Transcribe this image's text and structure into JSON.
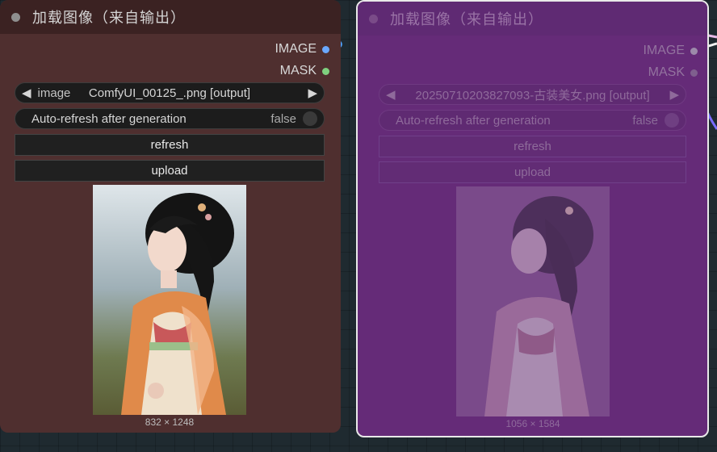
{
  "nodes": [
    {
      "title": "加载图像（来自输出）",
      "outputs": {
        "image": "IMAGE",
        "mask": "MASK"
      },
      "image_widget": {
        "label": "image",
        "value": "ComfyUI_00125_.png [output]"
      },
      "auto_refresh": {
        "label": "Auto-refresh after generation",
        "value": "false"
      },
      "refresh_label": "refresh",
      "upload_label": "upload",
      "image_size": "832 × 1248"
    },
    {
      "title": "加载图像（来自输出）",
      "outputs": {
        "image": "IMAGE",
        "mask": "MASK"
      },
      "image_widget": {
        "label": "",
        "value": "20250710203827093-古装美女.png [output]"
      },
      "auto_refresh": {
        "label": "Auto-refresh after generation",
        "value": "false"
      },
      "refresh_label": "refresh",
      "upload_label": "upload",
      "image_size": "1056 × 1584"
    }
  ],
  "colors": {
    "image_pin": "#6aa8ff",
    "mask_pin": "#7fd07f",
    "left_node_bg": "#4f2f2f",
    "right_node_bg": "#652b78",
    "canvas_bg": "#1f2a30"
  }
}
